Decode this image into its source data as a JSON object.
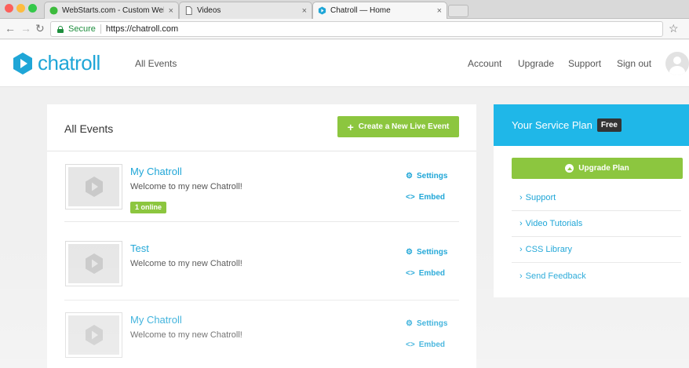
{
  "browser": {
    "tabs": [
      {
        "title": "WebStarts.com - Custom Web",
        "active": false
      },
      {
        "title": "Videos",
        "active": false
      },
      {
        "title": "Chatroll — Home",
        "active": true
      }
    ],
    "address": {
      "secure_label": "Secure",
      "url": "https://chatroll.com"
    }
  },
  "header": {
    "logo_text": "chatroll",
    "all_events_link": "All Events",
    "nav": [
      "Account",
      "Upgrade",
      "Support",
      "Sign out"
    ]
  },
  "events": {
    "title": "All Events",
    "create_button": "Create a New Live Event",
    "items": [
      {
        "name": "My Chatroll",
        "description": "Welcome to my new Chatroll!",
        "badge": "1 online",
        "settings": "Settings",
        "embed": "Embed"
      },
      {
        "name": "Test",
        "description": "Welcome to my new Chatroll!",
        "badge": "",
        "settings": "Settings",
        "embed": "Embed"
      },
      {
        "name": "My Chatroll",
        "description": "Welcome to my new Chatroll!",
        "badge": "",
        "settings": "Settings",
        "embed": "Embed"
      }
    ]
  },
  "plan": {
    "title": "Your Service Plan",
    "badge": "Free",
    "upgrade_button": "Upgrade Plan",
    "links": [
      "Support",
      "Video Tutorials",
      "CSS Library",
      "Send Feedback"
    ]
  },
  "colors": {
    "brand": "#1fa6d7",
    "plan_header": "#1fb7e8",
    "accent_green": "#8cc63f",
    "badge_dark": "#333333"
  },
  "icons": [
    "chatroll-logo-icon",
    "gear-icon",
    "embed-code-icon",
    "play-icon",
    "chevron-right-icon",
    "plus-icon",
    "upload-circle-icon",
    "lock-icon",
    "star-icon",
    "avatar-icon"
  ]
}
